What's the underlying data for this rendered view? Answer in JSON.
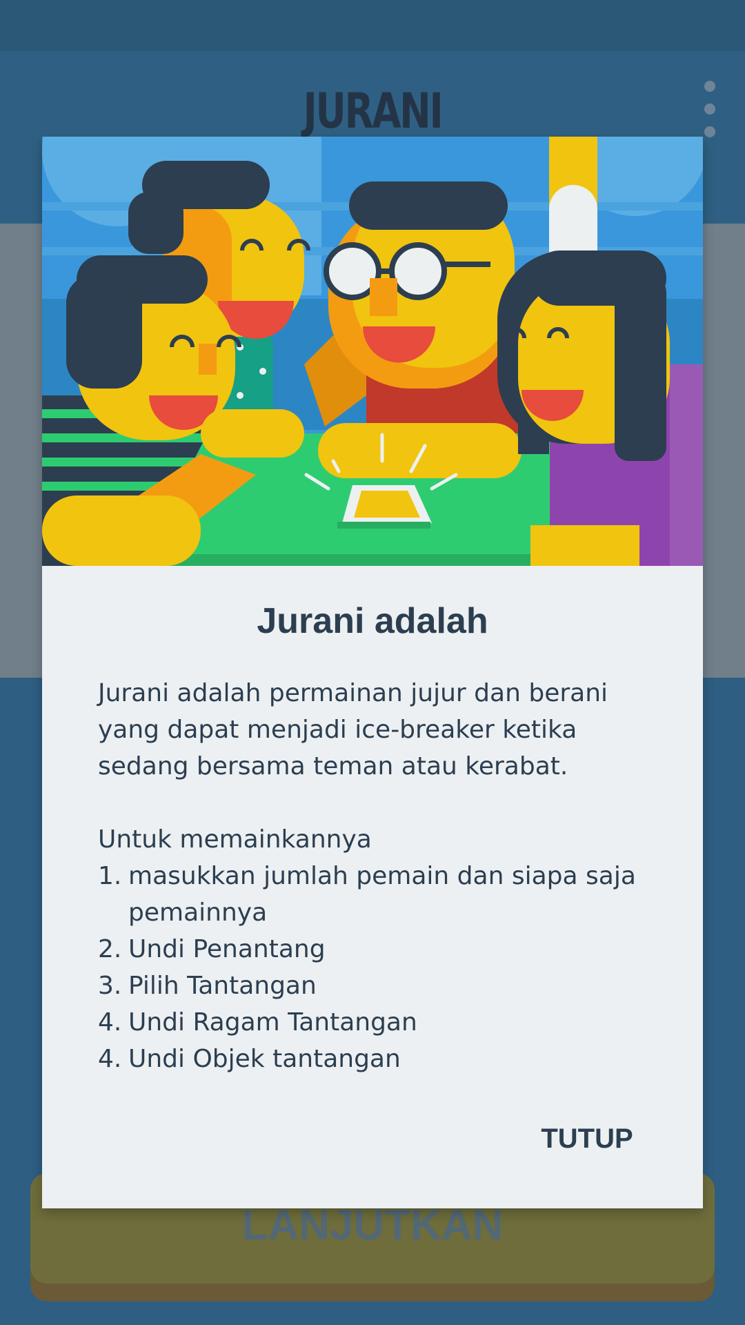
{
  "app": {
    "title": "JURANI",
    "menu_icon": "more-vert-icon"
  },
  "dialog": {
    "illustration": "group-of-friends-playing-illustration",
    "title": "Jurani adalah",
    "intro": "Jurani adalah permainan jujur dan berani yang dapat menjadi ice-breaker ketika sedang bersama teman atau kerabat.",
    "steps_heading": "Untuk memainkannya",
    "steps": [
      {
        "num": "1.",
        "text": "masukkan jumlah pemain dan siapa saja pemainnya"
      },
      {
        "num": "2.",
        "text": "Undi Penantang"
      },
      {
        "num": "3.",
        "text": "Pilih Tantangan"
      },
      {
        "num": "4.",
        "text": "Undi Ragam Tantangan"
      },
      {
        "num": "4.",
        "text": "Undi Objek tantangan"
      }
    ],
    "close_label": "TUTUP"
  },
  "background": {
    "continue_label": "LANJUTKAN"
  },
  "colors": {
    "primary": "#2e5e82",
    "dialog_bg": "#ecf0f2",
    "text": "#2c3e50",
    "button": "#6e6d3b"
  }
}
